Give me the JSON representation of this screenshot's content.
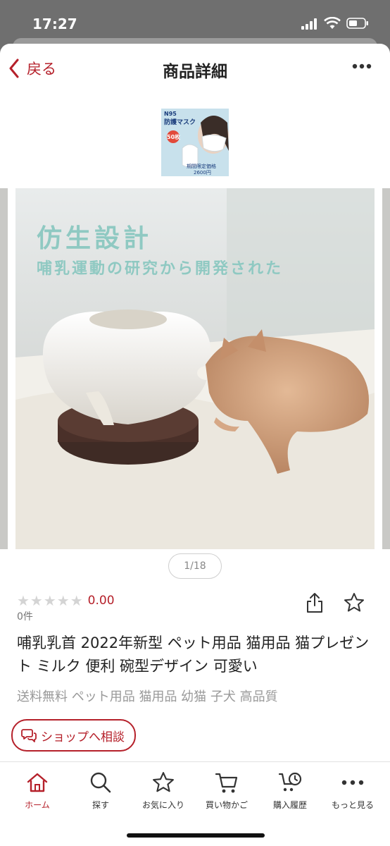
{
  "status_bar": {
    "time": "17:27"
  },
  "nav": {
    "back_label": "戻る",
    "title": "商品詳細"
  },
  "ad": {
    "label": "N95",
    "title": "防護マスク",
    "badge": "50枚",
    "price_note": "期間限定価格",
    "price": "2600円"
  },
  "product": {
    "image_headline": "仿生設計",
    "image_subline": "哺乳運動の研究から開発された",
    "image_counter": "1/18",
    "rating_value": "0.00",
    "review_count": "0件",
    "title": "哺乳乳首 2022年新型 ペット用品 猫用品 猫プレゼント ミルク 便利 碗型デザイン 可愛い",
    "tags": "送料無料 ペット用品  猫用品 幼猫 子犬 高品質"
  },
  "consult_label": "ショップへ相談",
  "tabs": [
    {
      "label": "ホーム",
      "icon": "home-icon",
      "active": true
    },
    {
      "label": "探す",
      "icon": "search-icon"
    },
    {
      "label": "お気に入り",
      "icon": "star-icon"
    },
    {
      "label": "買い物かご",
      "icon": "cart-icon"
    },
    {
      "label": "購入履歴",
      "icon": "history-icon"
    },
    {
      "label": "もっと見る",
      "icon": "more-icon"
    }
  ],
  "colors": {
    "accent": "#b5202a",
    "headline": "#8fc9c2"
  }
}
